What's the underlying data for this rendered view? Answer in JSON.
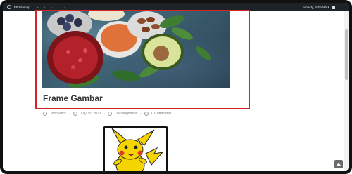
{
  "adminbar": {
    "site_name": "ERSitemap",
    "menu_items": [
      "",
      "",
      "",
      "",
      ""
    ],
    "greeting": "Howdy, John Wick"
  },
  "post": {
    "title": "Frame Gambar",
    "author": "John Wick",
    "date": "July 30, 2023",
    "category": "Uncategorized",
    "comments": "0 Comments"
  },
  "colors": {
    "highlight": "#d32626",
    "adminbar_bg": "#1d2327"
  },
  "icons": {
    "wp_logo": "wordpress-icon",
    "author": "user-icon",
    "date": "clock-icon",
    "category": "folder-icon",
    "comments": "comment-icon",
    "back_to_top": "arrow-up-icon"
  }
}
